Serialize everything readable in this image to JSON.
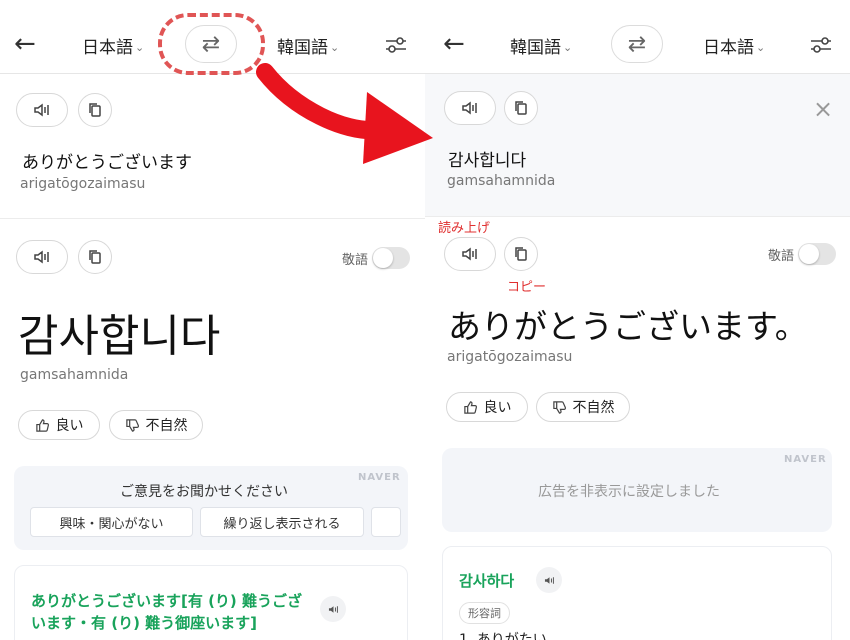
{
  "left": {
    "header": {
      "source_lang": "日本語",
      "target_lang": "韓国語",
      "swap_glyph": "⇄",
      "back_glyph": "←"
    },
    "source": {
      "text": "ありがとうございます",
      "romanization": "arigatōgozaimasu"
    },
    "result": {
      "text": "감사합니다",
      "romanization": "gamsahamnida",
      "honorific_label": "敬語"
    },
    "feedback": {
      "good": "良い",
      "unnatural": "不自然"
    },
    "survey": {
      "brand": "NAVER",
      "question": "ご意見をお聞かせください",
      "options": [
        "興味・関心がない",
        "繰り返し表示される"
      ]
    },
    "dictionary": {
      "entry": "ありがとうございます[有 (り) 難うござ",
      "entry_line2": "います・有 (り) 難う御座います]"
    }
  },
  "right": {
    "header": {
      "source_lang": "韓国語",
      "target_lang": "日本語",
      "swap_glyph": "⇄",
      "back_glyph": "←"
    },
    "source": {
      "text": "감사합니다",
      "romanization": "gamsahamnida",
      "close_glyph": "×"
    },
    "result": {
      "text": "ありがとうございます。",
      "romanization": "arigatōgozaimasu",
      "honorific_label": "敬語"
    },
    "annotations": {
      "read_aloud": "読み上げ",
      "copy": "コピー"
    },
    "feedback": {
      "good": "良い",
      "unnatural": "不自然"
    },
    "ad": {
      "brand": "NAVER",
      "message": "広告を非表示に設定しました"
    },
    "dictionary": {
      "headword": "감사하다",
      "pos": "形容詞",
      "sense": "1. ありがたい"
    }
  },
  "colors": {
    "accent_green": "#19a35b",
    "annotation_red": "#e03030",
    "arrow_red": "#e8141e"
  },
  "icons": [
    "back-arrow-icon",
    "swap-icon",
    "settings-sliders-icon",
    "speaker-icon",
    "copy-icon",
    "thumbs-up-icon",
    "thumbs-down-icon",
    "close-icon",
    "chevron-down-icon"
  ]
}
